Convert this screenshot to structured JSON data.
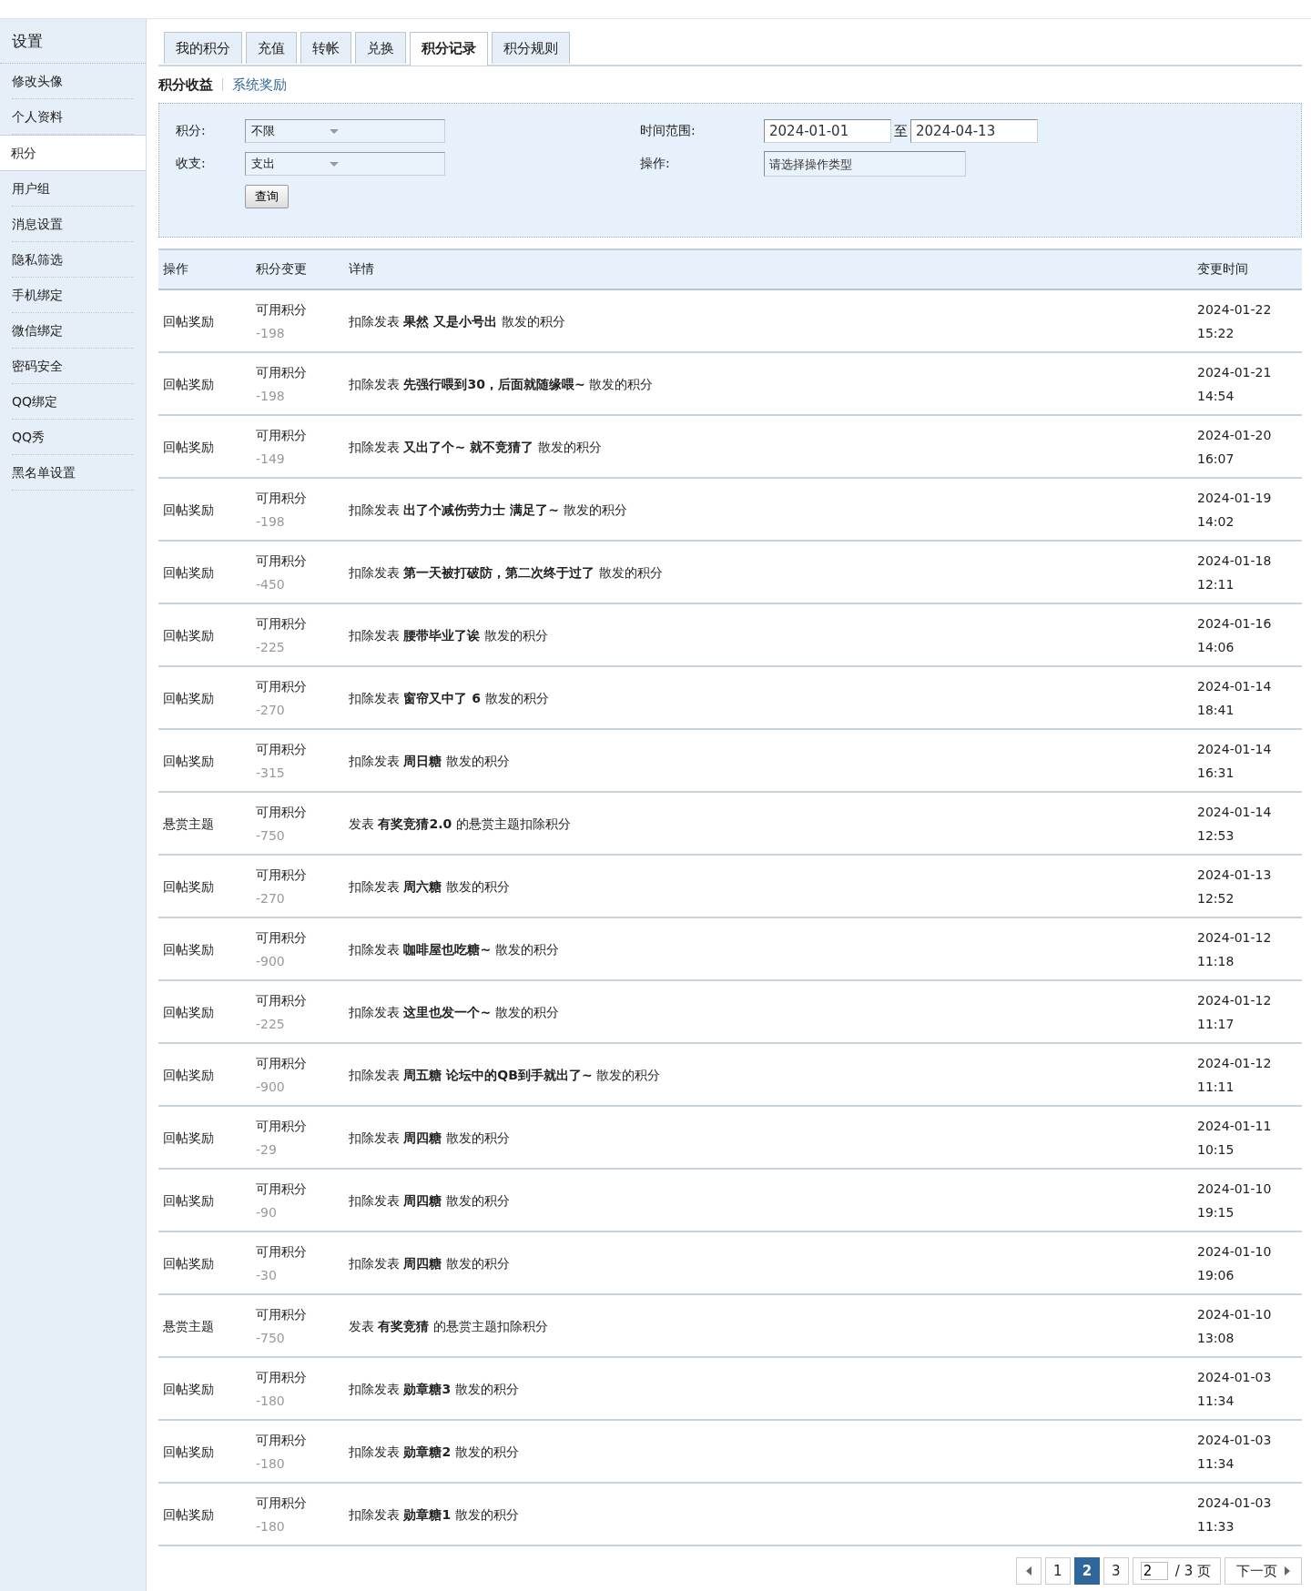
{
  "sidebar": {
    "title": "设置",
    "items": [
      {
        "label": "修改头像",
        "selected": false
      },
      {
        "label": "个人资料",
        "selected": false
      },
      {
        "label": "积分",
        "selected": true
      },
      {
        "label": "用户组",
        "selected": false
      },
      {
        "label": "消息设置",
        "selected": false
      },
      {
        "label": "隐私筛选",
        "selected": false
      },
      {
        "label": "手机绑定",
        "selected": false
      },
      {
        "label": "微信绑定",
        "selected": false
      },
      {
        "label": "密码安全",
        "selected": false
      },
      {
        "label": "QQ绑定",
        "selected": false
      },
      {
        "label": "QQ秀",
        "selected": false
      },
      {
        "label": "黑名单设置",
        "selected": false
      }
    ]
  },
  "tabs": [
    {
      "label": "我的积分",
      "selected": false
    },
    {
      "label": "充值",
      "selected": false
    },
    {
      "label": "转帐",
      "selected": false
    },
    {
      "label": "兑换",
      "selected": false
    },
    {
      "label": "积分记录",
      "selected": true
    },
    {
      "label": "积分规则",
      "selected": false
    }
  ],
  "subtabs": [
    {
      "label": "积分收益",
      "selected": true
    },
    {
      "label": "系统奖励",
      "selected": false
    }
  ],
  "filter": {
    "credit_label": "积分:",
    "credit_value": "不限",
    "type_label": "收支:",
    "type_value": "支出",
    "query_button": "查询",
    "range_label": "时间范围:",
    "range_start": "2024-01-01",
    "range_sep": "至",
    "range_end": "2024-04-13",
    "op_label": "操作:",
    "op_placeholder": "请选择操作类型"
  },
  "table": {
    "columns": [
      "操作",
      "积分变更",
      "详情",
      "变更时间"
    ],
    "rows": [
      {
        "action": "回帖奖励",
        "credit": "可用积分",
        "change": "-198",
        "detail": "扣除发表 **果然 又是小号出** 散发的积分",
        "date": "2024-01-22",
        "time": "15:22"
      },
      {
        "action": "回帖奖励",
        "credit": "可用积分",
        "change": "-198",
        "detail": "扣除发表 **先强行喂到30，后面就随缘喂~** 散发的积分",
        "date": "2024-01-21",
        "time": "14:54"
      },
      {
        "action": "回帖奖励",
        "credit": "可用积分",
        "change": "-149",
        "detail": "扣除发表 **又出了个~ 就不竞猜了** 散发的积分",
        "date": "2024-01-20",
        "time": "16:07"
      },
      {
        "action": "回帖奖励",
        "credit": "可用积分",
        "change": "-198",
        "detail": "扣除发表 **出了个减伤劳力士 满足了~** 散发的积分",
        "date": "2024-01-19",
        "time": "14:02"
      },
      {
        "action": "回帖奖励",
        "credit": "可用积分",
        "change": "-450",
        "detail": "扣除发表 **第一天被打破防，第二次终于过了** 散发的积分",
        "date": "2024-01-18",
        "time": "12:11"
      },
      {
        "action": "回帖奖励",
        "credit": "可用积分",
        "change": "-225",
        "detail": "扣除发表 **腰带毕业了诶** 散发的积分",
        "date": "2024-01-16",
        "time": "14:06"
      },
      {
        "action": "回帖奖励",
        "credit": "可用积分",
        "change": "-270",
        "detail": "扣除发表 **窗帘又中了 6** 散发的积分",
        "date": "2024-01-14",
        "time": "18:41"
      },
      {
        "action": "回帖奖励",
        "credit": "可用积分",
        "change": "-315",
        "detail": "扣除发表 **周日糖** 散发的积分",
        "date": "2024-01-14",
        "time": "16:31"
      },
      {
        "action": "悬赏主题",
        "credit": "可用积分",
        "change": "-750",
        "detail": "发表 **有奖竞猜2.0** 的悬赏主题扣除积分",
        "date": "2024-01-14",
        "time": "12:53"
      },
      {
        "action": "回帖奖励",
        "credit": "可用积分",
        "change": "-270",
        "detail": "扣除发表 **周六糖** 散发的积分",
        "date": "2024-01-13",
        "time": "12:52"
      },
      {
        "action": "回帖奖励",
        "credit": "可用积分",
        "change": "-900",
        "detail": "扣除发表 **咖啡屋也吃糖~** 散发的积分",
        "date": "2024-01-12",
        "time": "11:18"
      },
      {
        "action": "回帖奖励",
        "credit": "可用积分",
        "change": "-225",
        "detail": "扣除发表 **这里也发一个~** 散发的积分",
        "date": "2024-01-12",
        "time": "11:17"
      },
      {
        "action": "回帖奖励",
        "credit": "可用积分",
        "change": "-900",
        "detail": "扣除发表 **周五糖 论坛中的QB到手就出了~** 散发的积分",
        "date": "2024-01-12",
        "time": "11:11"
      },
      {
        "action": "回帖奖励",
        "credit": "可用积分",
        "change": "-29",
        "detail": "扣除发表 **周四糖** 散发的积分",
        "date": "2024-01-11",
        "time": "10:15"
      },
      {
        "action": "回帖奖励",
        "credit": "可用积分",
        "change": "-90",
        "detail": "扣除发表 **周四糖** 散发的积分",
        "date": "2024-01-10",
        "time": "19:15"
      },
      {
        "action": "回帖奖励",
        "credit": "可用积分",
        "change": "-30",
        "detail": "扣除发表 **周四糖** 散发的积分",
        "date": "2024-01-10",
        "time": "19:06"
      },
      {
        "action": "悬赏主题",
        "credit": "可用积分",
        "change": "-750",
        "detail": "发表 **有奖竞猜** 的悬赏主题扣除积分",
        "date": "2024-01-10",
        "time": "13:08"
      },
      {
        "action": "回帖奖励",
        "credit": "可用积分",
        "change": "-180",
        "detail": "扣除发表 **勋章糖3** 散发的积分",
        "date": "2024-01-03",
        "time": "11:34"
      },
      {
        "action": "回帖奖励",
        "credit": "可用积分",
        "change": "-180",
        "detail": "扣除发表 **勋章糖2** 散发的积分",
        "date": "2024-01-03",
        "time": "11:34"
      },
      {
        "action": "回帖奖励",
        "credit": "可用积分",
        "change": "-180",
        "detail": "扣除发表 **勋章糖1** 散发的积分",
        "date": "2024-01-03",
        "time": "11:33"
      }
    ]
  },
  "pagination": {
    "pages": [
      {
        "label": "1",
        "selected": false
      },
      {
        "label": "2",
        "selected": true
      },
      {
        "label": "3",
        "selected": false
      }
    ],
    "page_input": "2",
    "total": "/ 3 页",
    "next": "下一页"
  }
}
